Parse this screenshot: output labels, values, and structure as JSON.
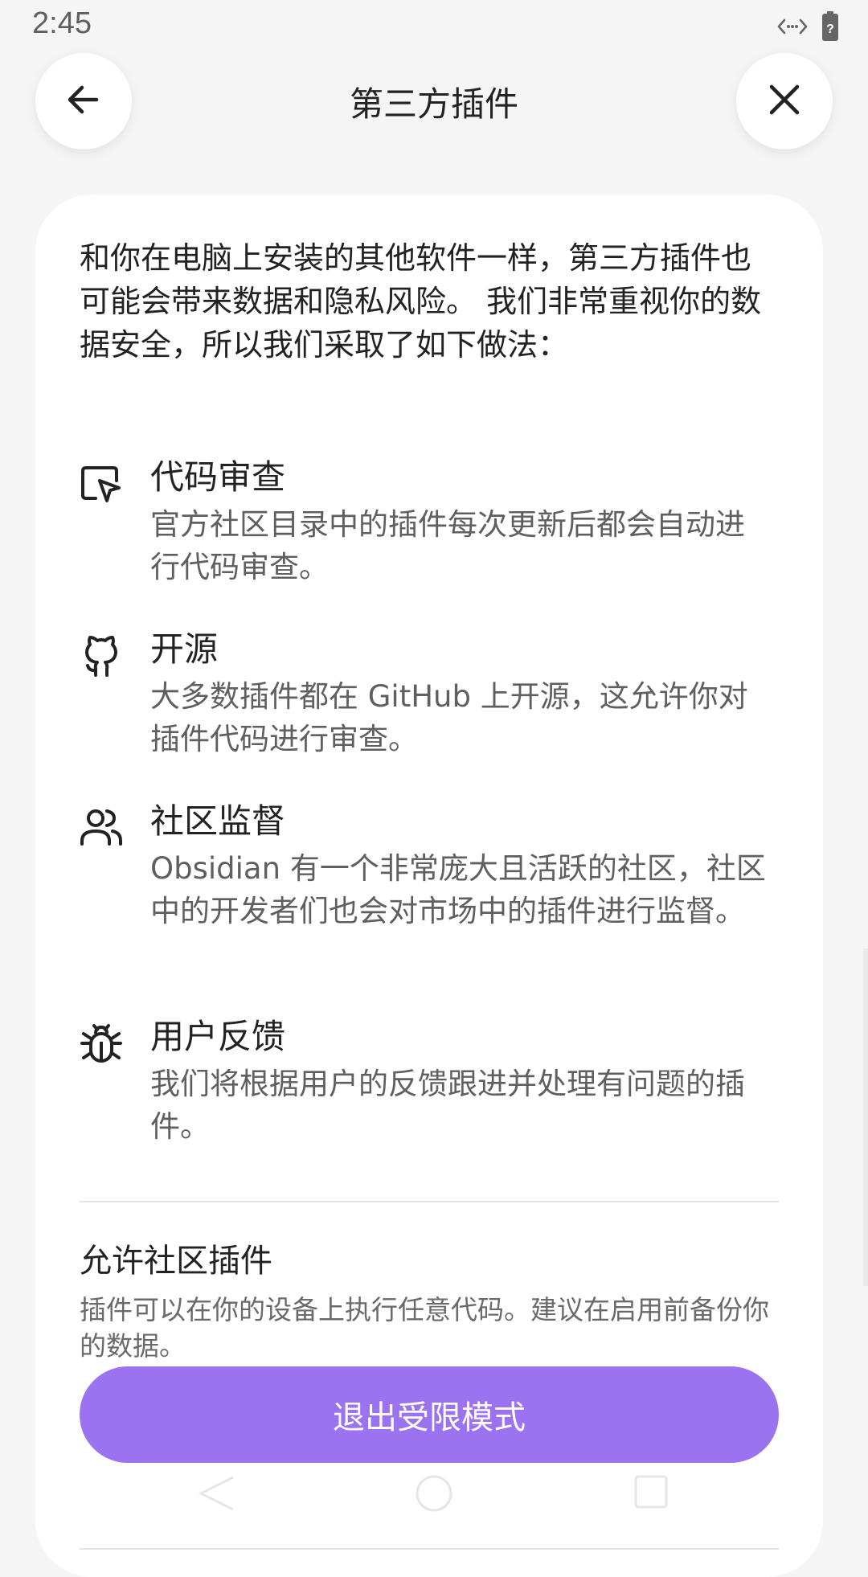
{
  "status_bar": {
    "time": "2:45"
  },
  "header": {
    "title": "第三方插件",
    "back_icon": "arrow-left-icon",
    "close_icon": "close-icon"
  },
  "intro": "和你在电脑上安装的其他软件一样，第三方插件也可能会带来数据和隐私风险。 我们非常重视你的数据安全，所以我们采取了如下做法：",
  "features": [
    {
      "icon": "cursor-window-icon",
      "title": "代码审查",
      "description": "官方社区目录中的插件每次更新后都会自动进行代码审查。"
    },
    {
      "icon": "github-icon",
      "title": "开源",
      "description": "大多数插件都在 GitHub 上开源，这允许你对插件代码进行审查。"
    },
    {
      "icon": "users-icon",
      "title": "社区监督",
      "description": "Obsidian 有一个非常庞大且活跃的社区，社区中的开发者们也会对市场中的插件进行监督。"
    },
    {
      "icon": "bug-icon",
      "title": "用户反馈",
      "description": "我们将根据用户的反馈跟进并处理有问题的插件。"
    }
  ],
  "setting": {
    "title": "允许社区插件",
    "description": "插件可以在你的设备上执行任意代码。建议在启用前备份你的数据。"
  },
  "exit_button": {
    "label": "退出受限模式"
  },
  "colors": {
    "accent": "#9b73f0",
    "background": "#f5f5f6",
    "card": "#ffffff"
  }
}
